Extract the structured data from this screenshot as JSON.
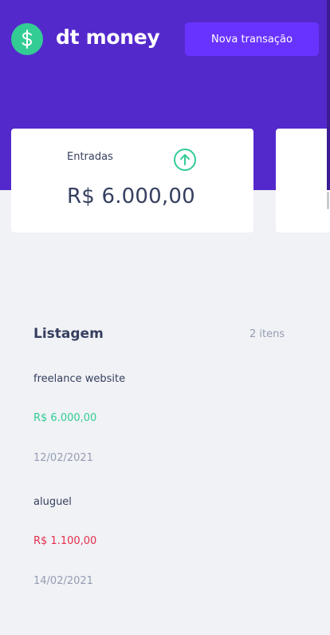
{
  "header": {
    "brand": "dt money",
    "new_transaction_label": "Nova transação",
    "colors": {
      "background": "#5429cc",
      "button": "#6933ff",
      "logo": "#33cc95"
    },
    "logo_icon": "dollar-icon"
  },
  "summary": {
    "income": {
      "title": "Entradas",
      "amount": "R$ 6.000,00",
      "icon": "arrow-up-circle-icon",
      "color": "#33cc95"
    }
  },
  "listing": {
    "title": "Listagem",
    "count": "2 itens",
    "transactions": [
      {
        "title": "freelance website",
        "amount": "R$ 6.000,00",
        "type": "deposit",
        "date": "12/02/2021"
      },
      {
        "title": "aluguel",
        "amount": "R$ 1.100,00",
        "type": "withdraw",
        "date": "14/02/2021"
      }
    ]
  },
  "colors": {
    "deposit": "#33cc95",
    "withdraw": "#e52e4d",
    "text": "#363f5f",
    "muted": "#969cb3"
  }
}
